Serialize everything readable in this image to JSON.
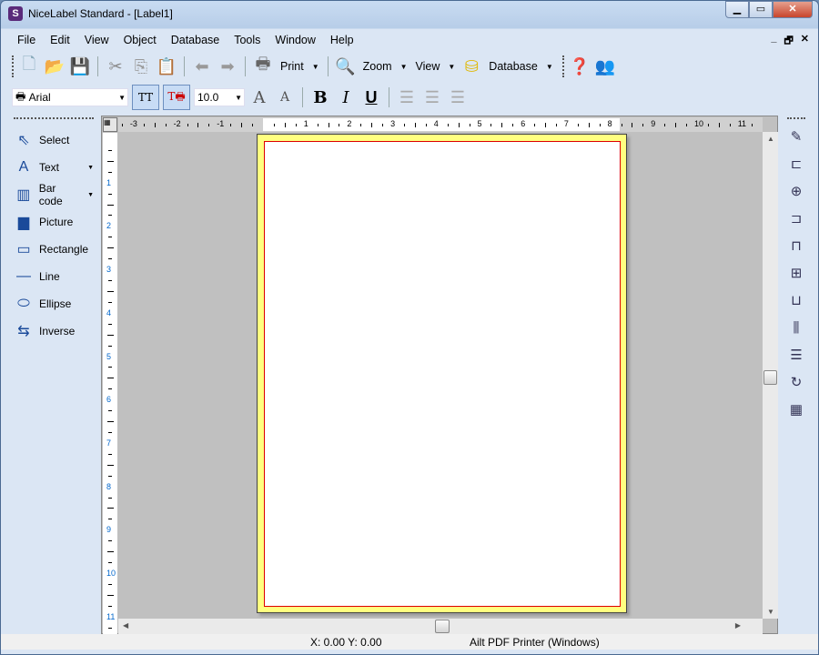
{
  "window": {
    "title": "NiceLabel Standard - [Label1]",
    "app_icon": "S",
    "controls": [
      "minimize",
      "maximize",
      "close"
    ]
  },
  "menu": [
    "File",
    "Edit",
    "View",
    "Object",
    "Database",
    "Tools",
    "Window",
    "Help"
  ],
  "mdi_controls": [
    "_",
    "🗗",
    "✕"
  ],
  "toolbar1": {
    "print": "Print",
    "zoom": "Zoom",
    "view": "View",
    "database": "Database"
  },
  "toolbar2": {
    "font": "Arial",
    "size": "10.0"
  },
  "tools": [
    {
      "label": "Select",
      "icon": "cursor-icon",
      "glyph": "⇖",
      "dropdown": false
    },
    {
      "label": "Text",
      "icon": "text-icon",
      "glyph": "A",
      "dropdown": true
    },
    {
      "label": "Bar code",
      "icon": "barcode-icon",
      "glyph": "▥",
      "dropdown": true
    },
    {
      "label": "Picture",
      "icon": "picture-icon",
      "glyph": "▆",
      "dropdown": false
    },
    {
      "label": "Rectangle",
      "icon": "rectangle-icon",
      "glyph": "▭",
      "dropdown": false
    },
    {
      "label": "Line",
      "icon": "line-icon",
      "glyph": "—",
      "dropdown": false
    },
    {
      "label": "Ellipse",
      "icon": "ellipse-icon",
      "glyph": "⬭",
      "dropdown": false
    },
    {
      "label": "Inverse",
      "icon": "inverse-icon",
      "glyph": "⇆",
      "dropdown": false
    }
  ],
  "ruler": {
    "h": [
      "-3",
      "-2",
      "-1",
      "1",
      "2",
      "3",
      "4",
      "5",
      "6",
      "7",
      "8",
      "9",
      "10",
      "11"
    ],
    "v": [
      "1",
      "2",
      "3",
      "4",
      "5",
      "6",
      "7",
      "8",
      "9",
      "10",
      "11"
    ]
  },
  "right_tools": [
    "color-pens-icon",
    "align-left-icon",
    "align-center-h-icon",
    "align-right-icon",
    "align-top-icon",
    "align-middle-icon",
    "align-bottom-icon",
    "space-horizontal-icon",
    "space-vertical-icon",
    "rotate-icon",
    "properties-icon"
  ],
  "status": {
    "coords": "X:  0.00 Y:  0.00",
    "printer": "Ailt PDF Printer (Windows)"
  },
  "colors": {
    "page_border": "#ffff80",
    "margin": "#dd0000",
    "workspace": "#c0c0c0"
  }
}
